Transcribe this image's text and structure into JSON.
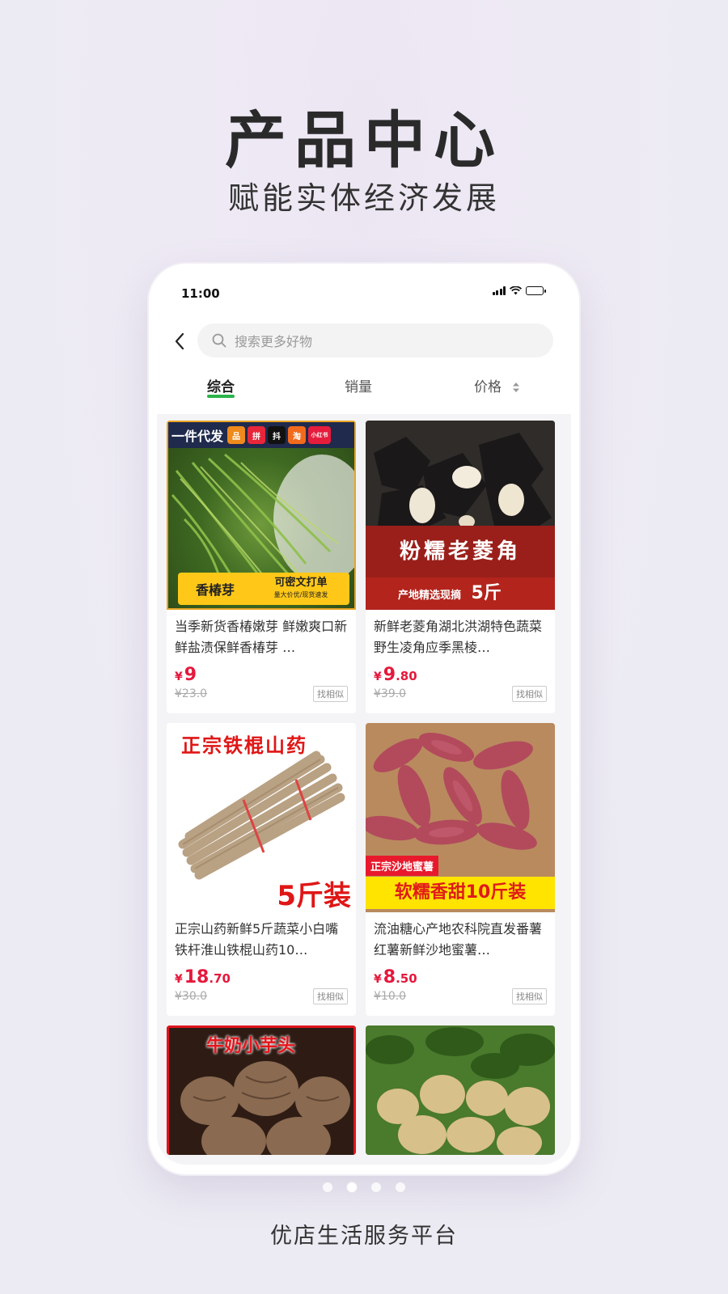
{
  "hero": {
    "title": "产品中心",
    "subtitle": "赋能实体经济发展"
  },
  "status_bar": {
    "time": "11:00"
  },
  "search": {
    "placeholder": "搜索更多好物"
  },
  "tabs": [
    {
      "label": "综合",
      "active": true
    },
    {
      "label": "销量",
      "active": false
    },
    {
      "label": "价格",
      "active": false
    }
  ],
  "products": [
    {
      "title": "当季新货香椿嫩芽 鲜嫩爽口新鲜盐渍保鲜香椿芽 …",
      "price_symbol": "¥",
      "price_int": "9",
      "price_dec": "",
      "original_price": "¥23.0",
      "similar_label": "找相似",
      "image": {
        "top_badge": "一件代发",
        "platforms": [
          "品",
          "拼",
          "抖",
          "淘",
          "小红书"
        ],
        "tag_main": "香椿芽",
        "tag_side": "可密文打单",
        "tag_small": "量大价优/现货速发"
      }
    },
    {
      "title": "新鲜老菱角湖北洪湖特色蔬菜野生凌角应季黑棱…",
      "price_symbol": "¥",
      "price_int": "9",
      "price_dec": ".80",
      "original_price": "¥39.0",
      "similar_label": "找相似",
      "image": {
        "banner_main": "粉糯老菱角",
        "banner_sub": "产地精选现摘",
        "banner_weight": "5斤"
      }
    },
    {
      "title": "正宗山药新鲜5斤蔬菜小白嘴铁杆淮山铁棍山药10…",
      "price_symbol": "¥",
      "price_int": "18",
      "price_dec": ".70",
      "original_price": "¥30.0",
      "similar_label": "找相似",
      "image": {
        "headline": "正宗铁棍山药",
        "weight": "5斤装"
      }
    },
    {
      "title": "流油糖心产地农科院直发番薯红薯新鲜沙地蜜薯…",
      "price_symbol": "¥",
      "price_int": "8",
      "price_dec": ".50",
      "original_price": "¥10.0",
      "similar_label": "找相似",
      "image": {
        "label_small": "正宗沙地蜜薯",
        "label_big": "软糯香甜10斤装"
      }
    },
    {
      "image": {
        "headline": "牛奶小芋头"
      }
    },
    {
      "image": {}
    }
  ],
  "pager": {
    "count": 4,
    "active_index": 1
  },
  "footer": {
    "text": "优店生活服务平台"
  },
  "colors": {
    "price": "#e5183c",
    "tab_underline": "#2bb34a",
    "background": "#eceaf2"
  }
}
